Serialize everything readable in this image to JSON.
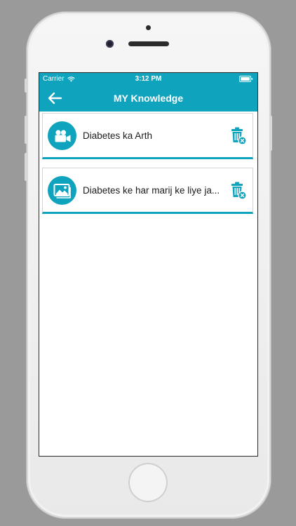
{
  "status_bar": {
    "carrier": "Carrier",
    "time": "3:12 PM",
    "wifi_icon": "wifi-icon",
    "battery_icon": "battery-icon"
  },
  "nav_bar": {
    "title": "MY Knowledge",
    "back_icon": "arrow-left-icon"
  },
  "colors": {
    "accent": "#0fa3be",
    "background": "#ffffff",
    "text": "#1b1b1b"
  },
  "items": [
    {
      "title": "Diabetes ka Arth",
      "type_icon": "video-camera-icon",
      "action_icon": "trash-delete-icon"
    },
    {
      "title": "Diabetes ke har marij ke liye ja...",
      "type_icon": "image-icon",
      "action_icon": "trash-delete-icon"
    }
  ]
}
